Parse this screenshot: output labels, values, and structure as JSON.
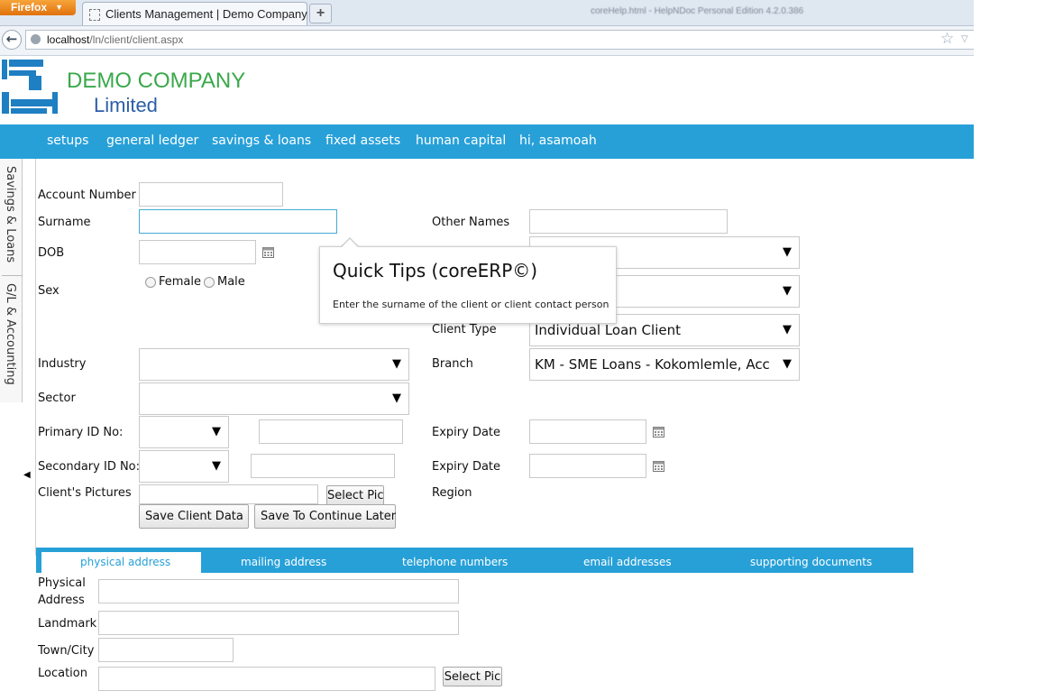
{
  "browser": {
    "menu_button": "Firefox",
    "tab_title": "Clients Management | Demo Company ...",
    "new_tab": "+",
    "titlebar_text": "coreHelp.html - HelpNDoc Personal Edition 4.2.0.386",
    "url_host": "localhost",
    "url_path": "/ln/client/client.aspx"
  },
  "header": {
    "company_name": "DEMO COMPANY",
    "company_sub": "Limited"
  },
  "menu": [
    {
      "label": "setups"
    },
    {
      "label": "general ledger"
    },
    {
      "label": "savings & loans"
    },
    {
      "label": "fixed assets"
    },
    {
      "label": "human capital"
    },
    {
      "label": "hi, asamoah"
    }
  ],
  "sidebar": {
    "tabs": [
      {
        "label": "Savings & Loans"
      },
      {
        "label": "G/L & Accounting"
      }
    ]
  },
  "form": {
    "account_number_label": "Account Number",
    "surname_label": "Surname",
    "other_names_label": "Other Names",
    "dob_label": "DOB",
    "sex_label": "Sex",
    "female_label": "Female",
    "male_label": "Male",
    "client_type_label": "Client Type",
    "client_type_value": "Individual Loan Client",
    "industry_label": "Industry",
    "branch_label": "Branch",
    "branch_value": "KM - SME Loans -  Kokomlemle, Accra",
    "sector_label": "Sector",
    "primary_id_label": "Primary ID No:",
    "secondary_id_label": "Secondary ID No:",
    "expiry_date_label": "Expiry Date",
    "expiry_date2_label": "Expiry Date",
    "clients_pictures_label": "Client's Pictures",
    "region_label": "Region",
    "select_pic_label": "Select Pic",
    "save_client_label": "Save Client Data",
    "save_later_label": "Save To Continue Later"
  },
  "tooltip": {
    "title": "Quick Tips (coreERP©)",
    "text": "Enter the surname of the client or client contact person"
  },
  "address_tabs": [
    {
      "label": "physical address",
      "active": true
    },
    {
      "label": "mailing address"
    },
    {
      "label": "telephone numbers"
    },
    {
      "label": "email addresses"
    },
    {
      "label": "supporting documents"
    }
  ],
  "address": {
    "physical_address_label_1": "Physical",
    "physical_address_label_2": "Address",
    "landmark_label": "Landmark",
    "town_city_label": "Town/City",
    "location_label": "Location",
    "select_pic_label": "Select Pic"
  },
  "colors": {
    "menu_blue": "#27a0d8",
    "company_green": "#3aa84a",
    "company_blue": "#2b5ea7"
  }
}
